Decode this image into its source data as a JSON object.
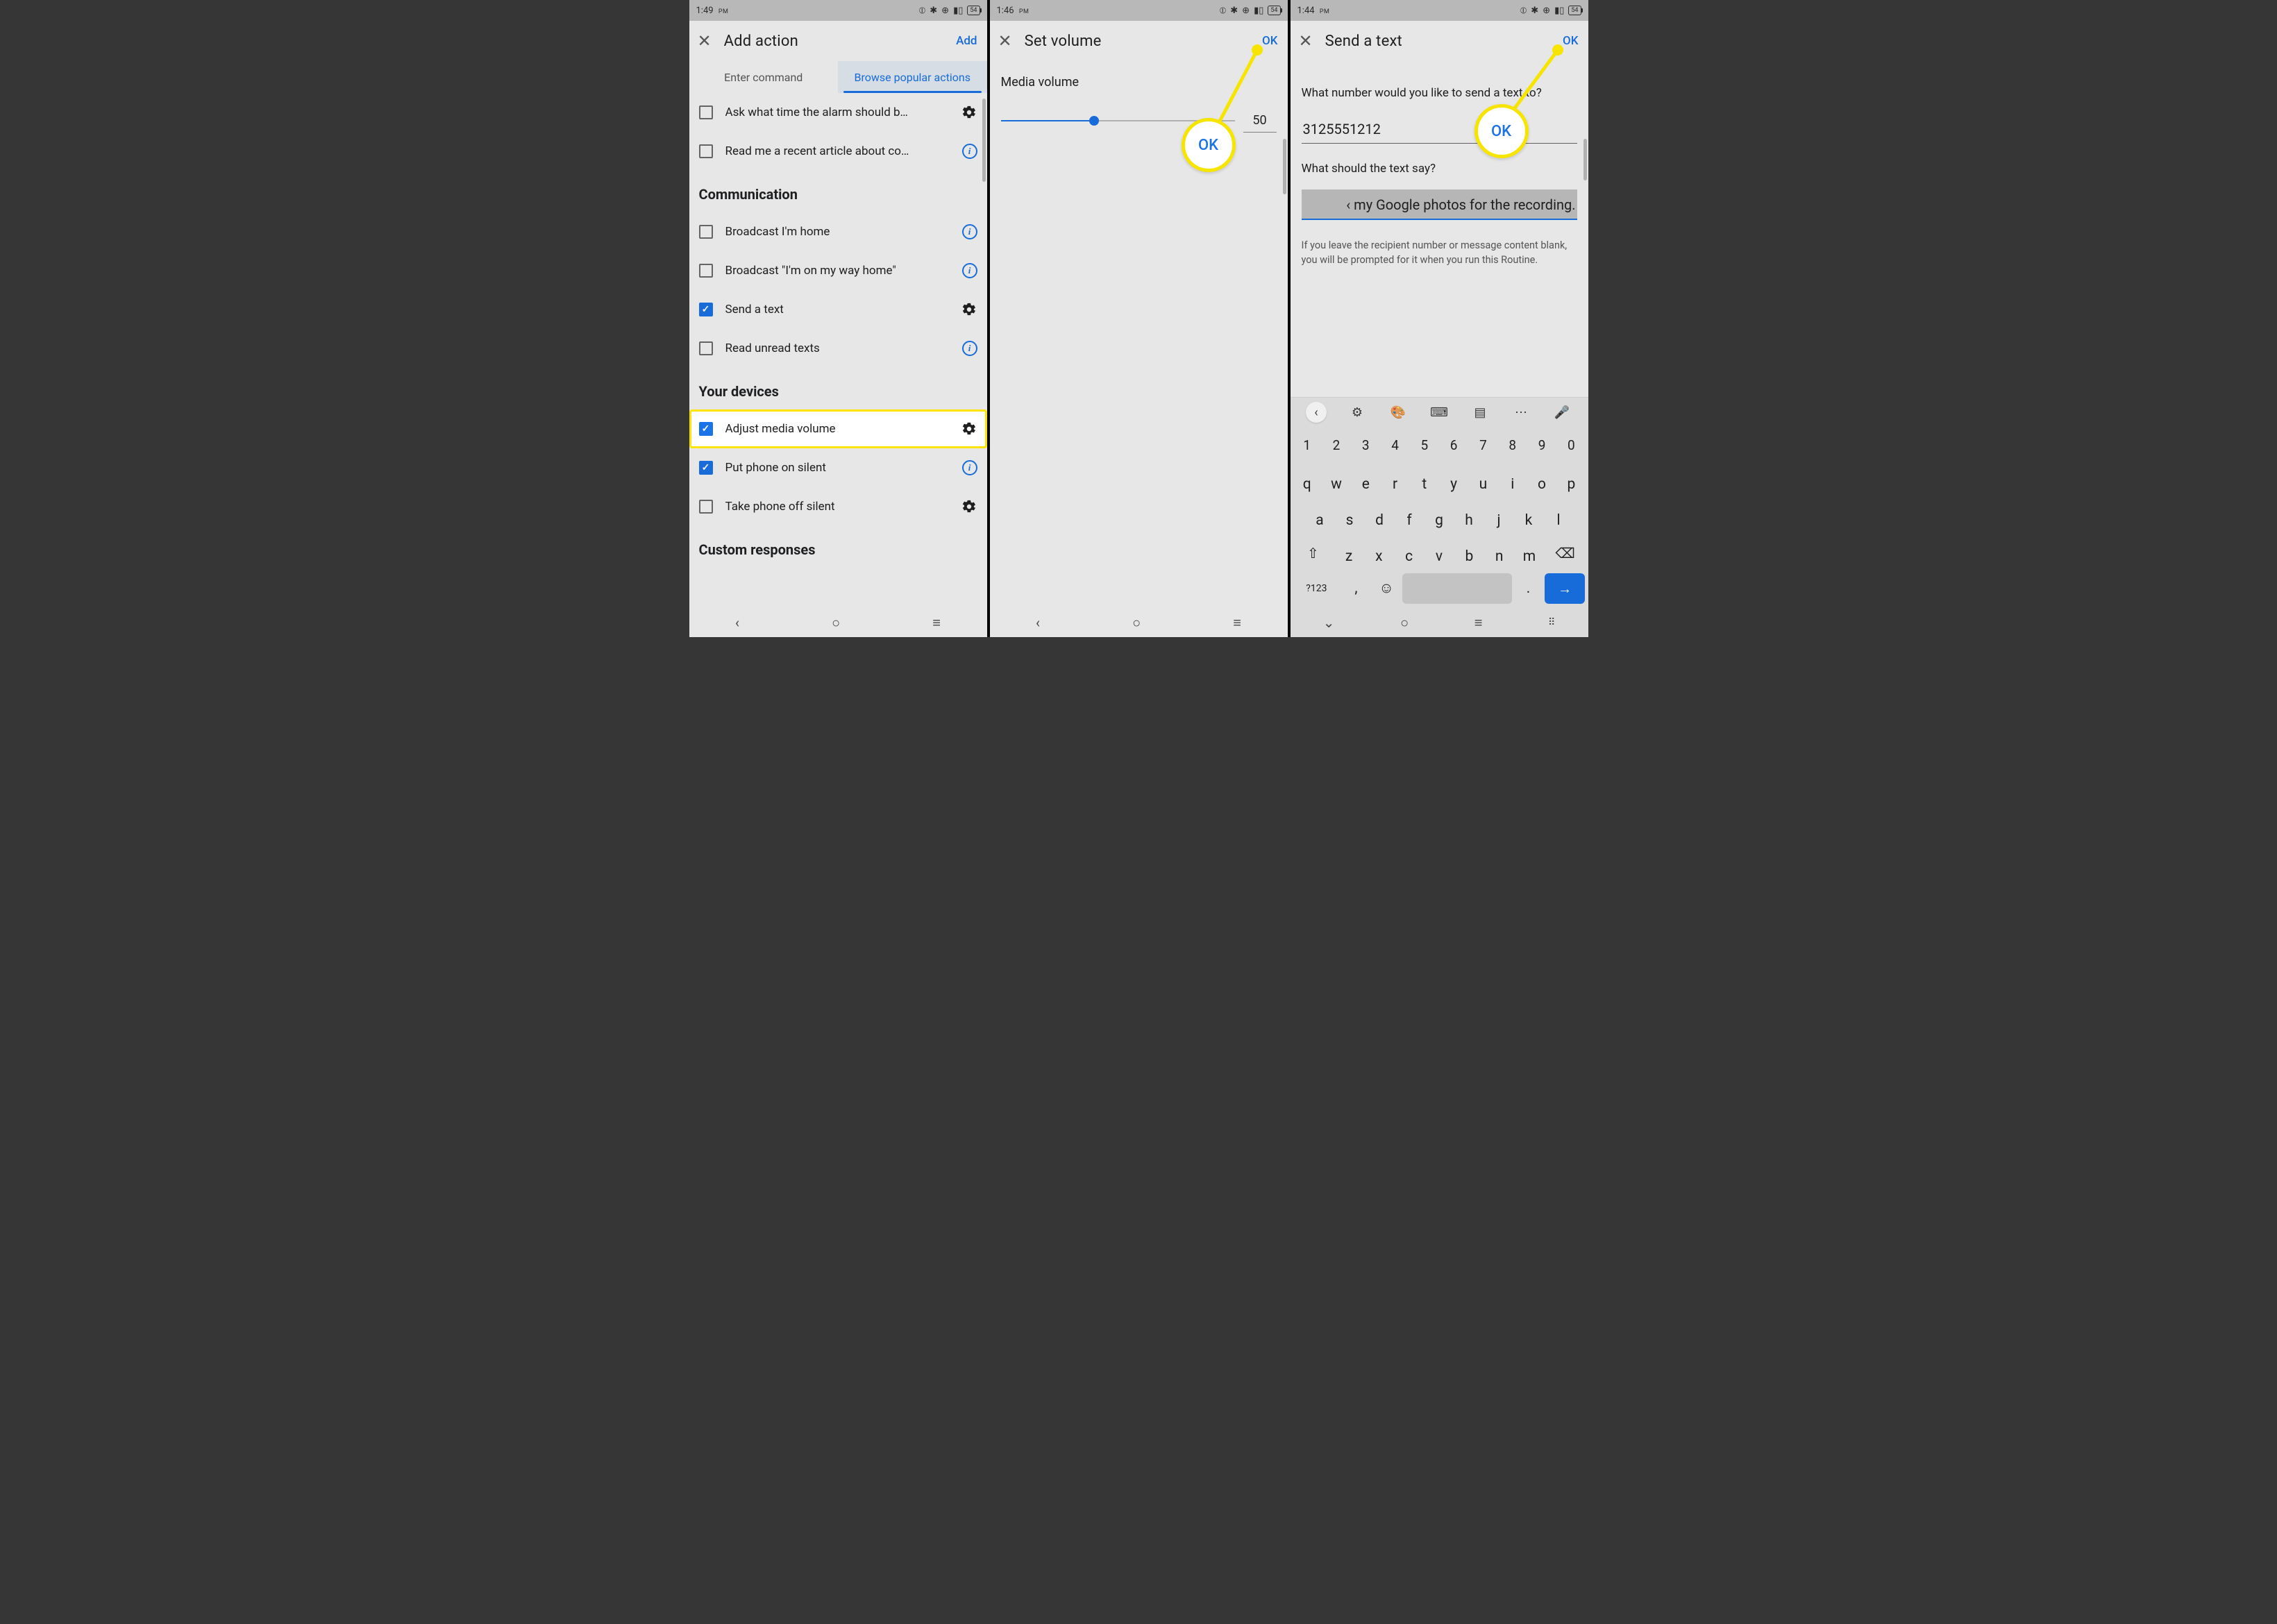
{
  "status": {
    "battery": "54",
    "icons": [
      "nfc",
      "bluetooth",
      "wifi",
      "signal"
    ]
  },
  "panel1": {
    "time": "1:49",
    "ampm": "PM",
    "header_title": "Add action",
    "header_action": "Add",
    "tabs": {
      "enter": "Enter command",
      "browse": "Browse popular actions"
    },
    "top_items": [
      {
        "label": "Ask what time the alarm should b…"
      },
      {
        "label": "Read me a recent article about co…"
      }
    ],
    "section_comm": "Communication",
    "comm_items": [
      {
        "label": "Broadcast I'm home"
      },
      {
        "label": "Broadcast \"I'm on my way home\""
      },
      {
        "label": "Send a text"
      },
      {
        "label": "Read unread texts"
      }
    ],
    "section_dev": "Your devices",
    "dev_items": [
      {
        "label": "Adjust media volume"
      },
      {
        "label": "Put phone on silent"
      },
      {
        "label": "Take phone off silent"
      }
    ],
    "section_custom": "Custom responses"
  },
  "panel2": {
    "time": "1:46",
    "ampm": "PM",
    "header_title": "Set volume",
    "header_action": "OK",
    "slider_label": "Media volume",
    "slider_value": "50",
    "callout": "OK"
  },
  "panel3": {
    "time": "1:44",
    "ampm": "PM",
    "header_title": "Send a text",
    "header_action": "OK",
    "q_number": "What number would you like to send a text to?",
    "number_value": "3125551212",
    "q_message": "What should the text say?",
    "message_value": "‹ my Google photos for the recording.",
    "hint": "If you leave the recipient number or message content blank, you will be prompted for it when you run this Routine.",
    "callout": "OK",
    "keyboard": {
      "row_num": [
        "1",
        "2",
        "3",
        "4",
        "5",
        "6",
        "7",
        "8",
        "9",
        "0"
      ],
      "row_q": [
        "q",
        "w",
        "e",
        "r",
        "t",
        "y",
        "u",
        "i",
        "o",
        "p"
      ],
      "row_a": [
        "a",
        "s",
        "d",
        "f",
        "g",
        "h",
        "j",
        "k",
        "l"
      ],
      "row_z": [
        "z",
        "x",
        "c",
        "v",
        "b",
        "n",
        "m"
      ],
      "sym": "?123",
      "comma": ",",
      "dot": "."
    }
  },
  "nav": {
    "back": "‹",
    "home": "○",
    "recent": "≡"
  }
}
